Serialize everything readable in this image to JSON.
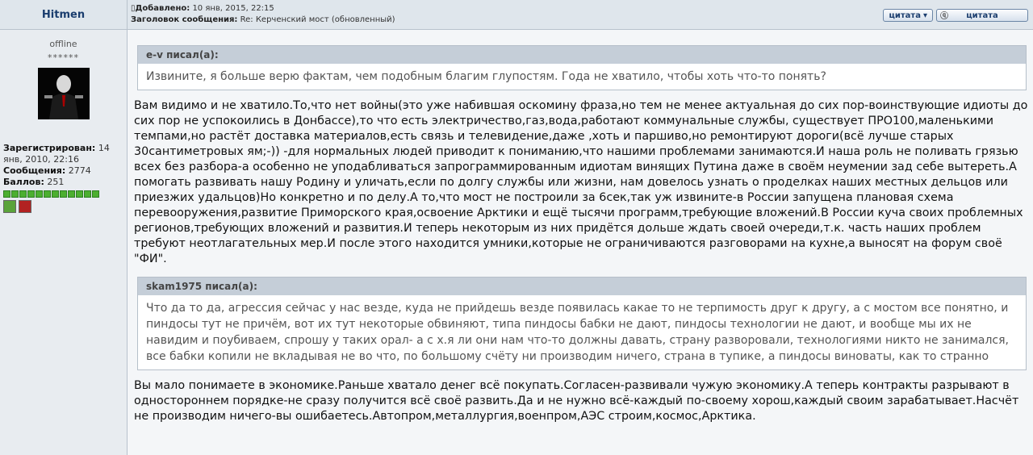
{
  "author": {
    "name": "Hitmen",
    "status": "offline",
    "rank": "******",
    "registered_label": "Зарегистрирован:",
    "registered_value": "14 янв, 2010, 22:16",
    "messages_label": "Сообщения:",
    "messages_value": "2774",
    "points_label": "Баллов:",
    "points_value": "251"
  },
  "post_meta": {
    "added_label": "Добавлено:",
    "added_value": "10 янв, 2015, 22:15",
    "subject_label": "Заголовок сообщения:",
    "subject_value": "Re: Керченский мост (обновленный)"
  },
  "buttons": {
    "quote": "цитата",
    "multi_quote": "цитата"
  },
  "quote1": {
    "title": "e-v писал(а):",
    "text": "Извините, я больше верю фактам, чем подобным благим глупостям. Года не хватило, чтобы хоть что-то понять?"
  },
  "body1": "Вам видимо и не хватило.То,что нет войны(это уже набившая оскомину фраза,но тем не менее актуальная до сих пор-воинствующие идиоты до сих пор не успокоились в Донбассе),то что есть электричество,газ,вода,работают коммунальные службы, существует ПРО100,маленькими темпами,но растёт доставка материалов,есть связь и телевидение,даже ,хоть и паршиво,но ремонтируют дороги(всё лучше старых 30сантиметровых ям;-)) -для нормальных людей приводит к пониманию,что нашими проблемами занимаются.И наша роль не поливать грязью всех без разбора-а особенно не уподабливаться запрограммированным идиотам винящих Путина даже в своём неумении зад себе вытереть.А помогать развивать нашу Родину и уличать,если по долгу службы или жизни, нам довелось узнать о проделках наших местных дельцов или приезжих удальцов)Но конкретно и по делу.А то,что мост не построили за 6сек,так уж извините-в России запущена плановая схема перевооружения,развитие Приморского края,освоение Арктики и ещё тысячи программ,требующие вложений.В России куча своих проблемных регионов,требующих вложений и развития.И теперь некоторым из них придётся дольше ждать своей очереди,т.к. часть наших проблем требуют неотлагательных мер.И после этого находится умники,которые не ограничиваются разговорами на кухне,а выносят на форум своё \"ФИ\".",
  "quote2": {
    "title": "skam1975 писал(а):",
    "text": "Что да то да, агрессия сейчас у нас везде, куда не прийдешь везде появилась какае то не терпимость друг к другу, а с мостом все понятно, и пиндосы тут не причём, вот их тут некоторые обвиняют, типа пиндосы бабки не дают, пиндосы технологии не дают, и вообще мы их не навидим и поубиваем, спрошу у таких орал- а с х.я ли они нам что-то должны давать, страну разворовали, технологиями никто не занимался, все бабки копили не вкладывая не во что, по большому счёту ни производим ничего, страна в тупике, а пиндосы виноваты, как то странно"
  },
  "body2": "Вы мало понимаете в экономике.Раньше хватало денег всё покупать.Согласен-развивали чужую экономику.А теперь контракты разрывают в одностороннем порядке-не сразу получится всё своё развить.Да и не нужно всё-каждый по-своему хорош,каждый своим зарабатывает.Насчёт не производим ничего-вы ошибаетесь.Автопром,металлургия,военпром,АЭС строим,космос,Арктика.",
  "colors": {
    "header_bg": "#dfe6ec",
    "quote_title_bg": "#c5ced8",
    "author_link": "#1a3d6e",
    "points_dot": "#4caf30"
  }
}
